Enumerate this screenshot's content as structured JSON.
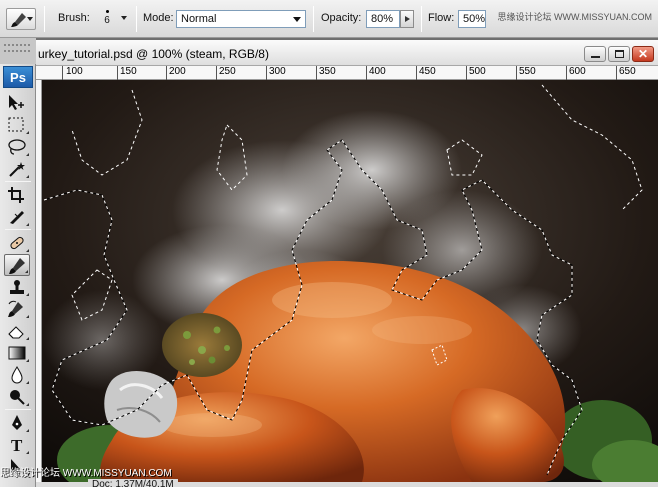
{
  "options_bar": {
    "brush_label": "Brush:",
    "brush_size": "6",
    "mode_label": "Mode:",
    "mode_value": "Normal",
    "opacity_label": "Opacity:",
    "opacity_value": "80%",
    "flow_label": "Flow:",
    "flow_value": "50%",
    "watermark": "思缘设计论坛 WWW.MISSYUAN.COM"
  },
  "toolbox": {
    "logo": "Ps",
    "tools": [
      "move",
      "marquee",
      "lasso",
      "magic-wand",
      "crop",
      "slice",
      "healing",
      "brush",
      "stamp",
      "history-brush",
      "eraser",
      "gradient",
      "blur",
      "dodge",
      "pen",
      "type",
      "path-select"
    ]
  },
  "document": {
    "title": "urkey_tutorial.psd @ 100% (steam, RGB/8)",
    "ruler_labels": [
      "100",
      "150",
      "200",
      "250",
      "300",
      "350",
      "400",
      "450",
      "500",
      "550",
      "600",
      "650"
    ],
    "status": "Doc: 1.37M/40.1M",
    "corner_watermark": "思缘设计论坛 WWW.MISSYUAN.COM"
  },
  "colors": {
    "turkey_skin": "#c8551a",
    "turkey_highlight": "#f0a05a",
    "background_dark": "#1a1410",
    "steam": "#cfcfcf",
    "parsley": "#3d6b2a",
    "ps_blue": "#1d5aa8"
  }
}
